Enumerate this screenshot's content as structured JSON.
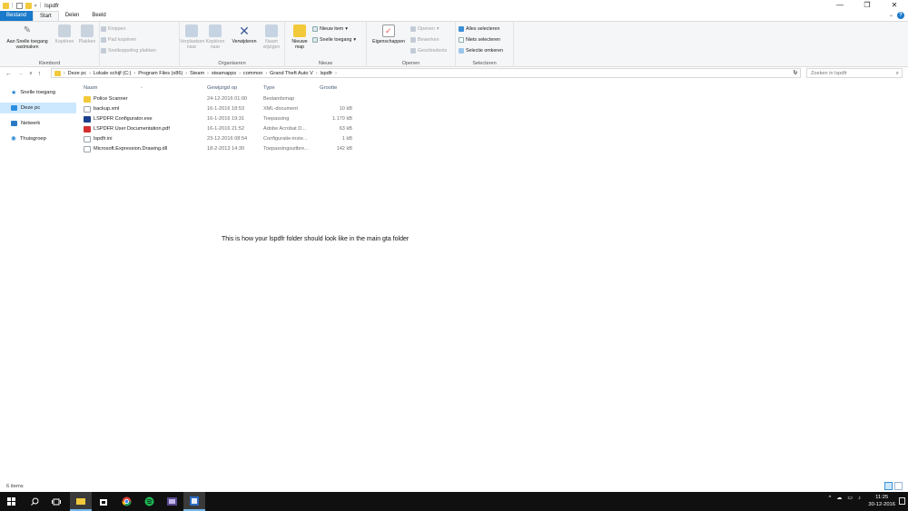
{
  "window": {
    "title": "lspdfr",
    "controls": [
      "—",
      "❐",
      "✕"
    ]
  },
  "ribbon_tabs": [
    {
      "label": "Bestand"
    },
    {
      "label": "Start"
    },
    {
      "label": "Delen"
    },
    {
      "label": "Beeld"
    }
  ],
  "ribbon": {
    "klembord": {
      "label": "Klembord",
      "pin": "Aan Snelle toegang vastmaken",
      "copy": "Kopiëren",
      "paste": "Plakken",
      "cut": "Knippen",
      "copy_path": "Pad kopiëren",
      "paste_shortcut": "Snelkoppeling plakken"
    },
    "organiseren": {
      "label": "Organiseren",
      "move_to": "Verplaatsen naar",
      "copy_to": "Kopiëren naar",
      "delete": "Verwijderen",
      "rename": "Naam wijzigen"
    },
    "nieuw": {
      "label": "Nieuw",
      "new_folder": "Nieuwe map",
      "new_item": "Nieuw item",
      "easy_access": "Snelle toegang"
    },
    "openen": {
      "label": "Openen",
      "properties": "Eigenschappen",
      "open": "Openen",
      "edit": "Bewerken",
      "history": "Geschiedenis"
    },
    "selecteren": {
      "label": "Selecteren",
      "select_all": "Alles selecteren",
      "select_none": "Niets selecteren",
      "invert": "Selectie omkeren"
    }
  },
  "address": {
    "crumbs": [
      "Deze pc",
      "Lokale schijf (C:)",
      "Program Files (x86)",
      "Steam",
      "steamapps",
      "common",
      "Grand Theft Auto V",
      "lspdfr"
    ],
    "search_placeholder": "Zoeken in lspdfr"
  },
  "nav": {
    "items": [
      {
        "label": "Snelle toegang",
        "color": "#1e7fd4"
      },
      {
        "label": "Deze pc",
        "color": "#2b8fe0"
      },
      {
        "label": "Netwerk",
        "color": "#2b7bc4"
      },
      {
        "label": "Thuisgroep",
        "color": "#2e8bd0"
      }
    ]
  },
  "columns": {
    "name": "Naam",
    "date": "Gewijzigd op",
    "type": "Type",
    "size": "Grootte"
  },
  "files": [
    {
      "name": "Police Scanner",
      "date": "24-12-2016 01:00",
      "type": "Bestandsmap",
      "size": "",
      "icon": "folder-icon",
      "color": "#f3c93c"
    },
    {
      "name": "backup.xml",
      "date": "16-1-2016 18:53",
      "type": "XML-document",
      "size": "10 kB",
      "icon": "xml-file-icon",
      "color": "#ffffff"
    },
    {
      "name": "LSPDFR Configurator.exe",
      "date": "16-1-2016 19:31",
      "type": "Toepassing",
      "size": "1.170 kB",
      "icon": "exe-file-icon",
      "color": "#1c3f8c"
    },
    {
      "name": "LSPDFR User Documentation.pdf",
      "date": "16-1-2016 21:52",
      "type": "Adobe Acrobat D...",
      "size": "63 kB",
      "icon": "pdf-file-icon",
      "color": "#d32f2f"
    },
    {
      "name": "lspdfr.ini",
      "date": "23-12-2016 08:54",
      "type": "Configuratie-inste...",
      "size": "1 kB",
      "icon": "ini-file-icon",
      "color": "#ffffff"
    },
    {
      "name": "Microsoft.Expression.Drawing.dll",
      "date": "18-2-2013 14:30",
      "type": "Toepassingsuitbre...",
      "size": "142 kB",
      "icon": "dll-file-icon",
      "color": "#ffffff"
    }
  ],
  "caption": "This is how your lspdfr folder should look like in the main gta folder",
  "status": {
    "count": "6 items"
  },
  "taskbar": {
    "time": "11:25",
    "date": "30-12-2016"
  }
}
